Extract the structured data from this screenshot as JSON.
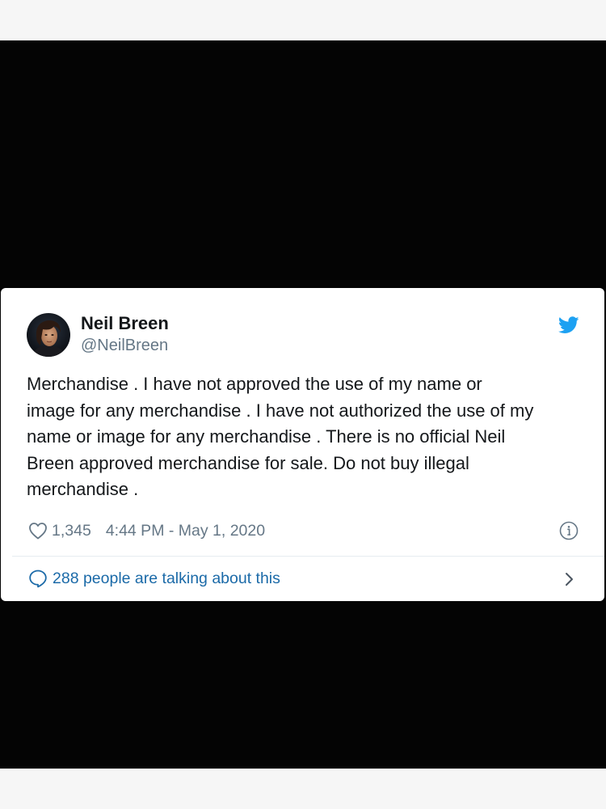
{
  "tweet": {
    "author": {
      "name": "Neil Breen",
      "handle": "@NeilBreen"
    },
    "text_lines": [
      "Merchandise . I have not approved the use of my name or",
      "image for any merchandise . I have not authorized the use of my",
      "name or image for any merchandise . There is no official Neil",
      "Breen approved merchandise for sale. Do not buy illegal",
      "merchandise ."
    ],
    "likes": "1,345",
    "timestamp": "4:44 PM - May 1, 2020",
    "conversation_label": "288 people are talking about this"
  },
  "icons": {
    "brand": "twitter-bird-icon",
    "like": "heart-icon",
    "info": "info-icon",
    "reply": "speech-bubble-icon",
    "more": "chevron-right-icon"
  },
  "colors": {
    "background": "#040404",
    "card": "#ffffff",
    "brand": "#1da1f2",
    "secondary_text": "#657786",
    "link": "#1b6aa8"
  }
}
